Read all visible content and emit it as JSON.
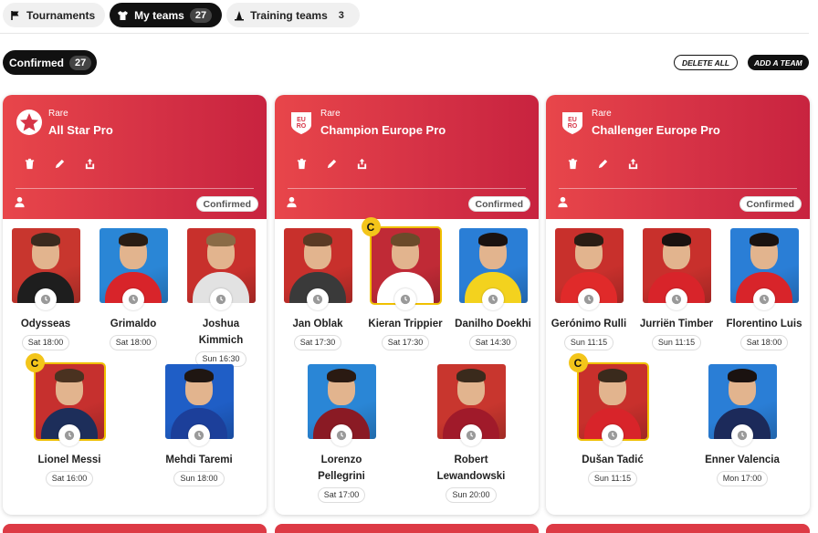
{
  "tabs": [
    {
      "label": "Tournaments",
      "icon": "flag-icon"
    },
    {
      "label": "My teams",
      "count": "27",
      "icon": "shirt-icon"
    },
    {
      "label": "Training teams",
      "count": "3",
      "icon": "cone-icon"
    }
  ],
  "filter": {
    "label": "Confirmed",
    "count": "27"
  },
  "buttons": {
    "delete_all": "DELETE ALL",
    "add_team": "ADD A TEAM"
  },
  "colors": {
    "accent": "#111111",
    "card_header": "#d63446",
    "captain": "#f3c51a"
  },
  "cards": [
    {
      "rarity": "Rare",
      "name": "All Star Pro",
      "badge_icon": "star-badge-icon",
      "status": "Confirmed",
      "players": [
        {
          "name": "Odysseas",
          "time": "Sat 18:00",
          "captain": false,
          "bg": "#c8362e",
          "hair": "#3b2a1e",
          "shirt": "#1e1e1e"
        },
        {
          "name": "Grimaldo",
          "time": "Sat 18:00",
          "captain": false,
          "bg": "#2a86d6",
          "hair": "#2a1d14",
          "shirt": "#d8242a"
        },
        {
          "name": "Joshua Kimmich",
          "time": "Sun 16:30",
          "captain": false,
          "bg": "#c8302c",
          "hair": "#8a6b46",
          "shirt": "#e2e2e2"
        },
        {
          "name": "Lionel Messi",
          "time": "Sat 16:00",
          "captain": true,
          "bg": "#c6302e",
          "hair": "#4a3220",
          "shirt": "#1d2e5a"
        },
        {
          "name": "Mehdi Taremi",
          "time": "Sun 18:00",
          "captain": false,
          "bg": "#1f5ec6",
          "hair": "#1f1612",
          "shirt": "#1c3f9a"
        }
      ]
    },
    {
      "rarity": "Rare",
      "name": "Champion Europe Pro",
      "badge_icon": "euro-badge-icon",
      "status": "Confirmed",
      "players": [
        {
          "name": "Jan Oblak",
          "time": "Sat 17:30",
          "captain": false,
          "bg": "#c8302c",
          "hair": "#5a3a24",
          "shirt": "#3a3a3a"
        },
        {
          "name": "Kieran Trippier",
          "time": "Sat 17:30",
          "captain": true,
          "bg": "#c02a36",
          "hair": "#6b4a2a",
          "shirt": "#ffffff"
        },
        {
          "name": "Danilho Doekhi",
          "time": "Sat 14:30",
          "captain": false,
          "bg": "#2a7ed6",
          "hair": "#1a1210",
          "shirt": "#f3d21e"
        },
        {
          "name": "Lorenzo Pellegrini",
          "time": "Sat 17:00",
          "captain": false,
          "bg": "#2a86d6",
          "hair": "#2a1a12",
          "shirt": "#8a1a24"
        },
        {
          "name": "Robert Lewandowski",
          "time": "Sun 20:00",
          "captain": false,
          "bg": "#c8362e",
          "hair": "#3a2a1c",
          "shirt": "#a01a2a"
        }
      ]
    },
    {
      "rarity": "Rare",
      "name": "Challenger Europe Pro",
      "badge_icon": "euro-badge-icon",
      "status": "Confirmed",
      "players": [
        {
          "name": "Gerónimo Rulli",
          "time": "Sun 11:15",
          "captain": false,
          "bg": "#c8302c",
          "hair": "#2a1d14",
          "shirt": "#e02a2a"
        },
        {
          "name": "Jurriën Timber",
          "time": "Sun 11:15",
          "captain": false,
          "bg": "#c8302c",
          "hair": "#1a1210",
          "shirt": "#d8242a"
        },
        {
          "name": "Florentino Luis",
          "time": "Sat 18:00",
          "captain": false,
          "bg": "#2a7ed6",
          "hair": "#1a1210",
          "shirt": "#d8242a"
        },
        {
          "name": "Dušan Tadić",
          "time": "Sun 11:15",
          "captain": true,
          "bg": "#c8302c",
          "hair": "#3a2a1c",
          "shirt": "#d8242a"
        },
        {
          "name": "Enner Valencia",
          "time": "Mon 17:00",
          "captain": false,
          "bg": "#2a7ed6",
          "hair": "#1a1210",
          "shirt": "#1c2a5a"
        }
      ]
    }
  ]
}
